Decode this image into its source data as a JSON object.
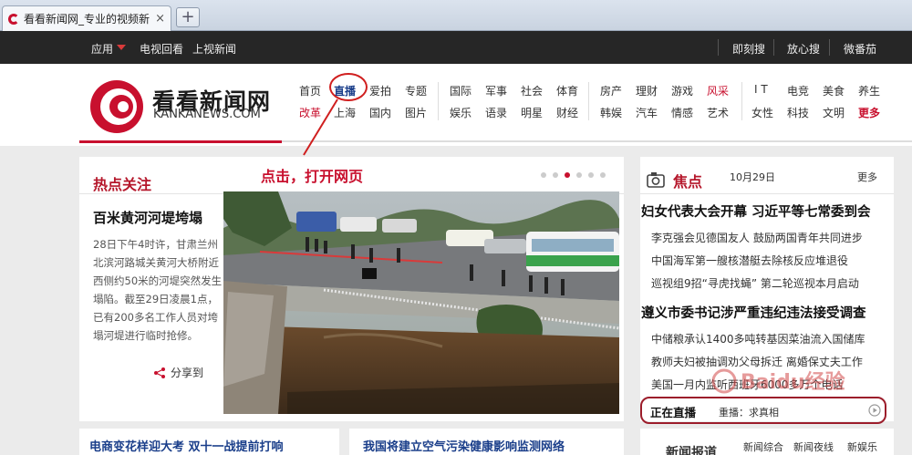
{
  "browser": {
    "tab_title": "看看新闻网_专业的视频新闻网",
    "close_glyph": "×",
    "newtab_glyph": "+"
  },
  "topnav": {
    "left": [
      "应用",
      "电视回看",
      "上视新闻"
    ],
    "right": [
      "即刻搜",
      "放心搜",
      "微番茄"
    ]
  },
  "brand": {
    "name": "看看新闻网",
    "domain": "KANKANEWS.COM",
    "color": "#c8102e"
  },
  "nav": {
    "rows": [
      [
        "首页",
        "直播",
        "爱拍",
        "专题",
        "国际",
        "军事",
        "社会",
        "体育",
        "房产",
        "理财",
        "游戏",
        "风采",
        "I T",
        "电竞",
        "美食",
        "养生"
      ],
      [
        "改革",
        "上海",
        "国内",
        "图片",
        "娱乐",
        "语录",
        "明星",
        "财经",
        "韩娱",
        "汽车",
        "情感",
        "艺术",
        "女性",
        "科技",
        "文明",
        "更多"
      ]
    ]
  },
  "annotation": {
    "text": "点击，打开网页"
  },
  "hot": {
    "title": "热点关注",
    "headline": "百米黄河河堤垮塌",
    "body": "28日下午4时许，甘肃兰州北滨河路城关黄河大桥附近西侧约50米的河堤突然发生塌陷。截至29日凌晨1点，已有200多名工作人员对垮塌河堤进行临时抢修。",
    "share": "分享到",
    "slide_count": 6,
    "active_slide": 3
  },
  "focus": {
    "title": "焦点",
    "date": "10月29日",
    "more": "更多",
    "headline1": "妇女代表大会开幕 习近平等七常委到会",
    "items1": [
      "李克强会见德国友人 鼓励两国青年共同进步",
      "中国海军第一艘核潜艇去除核反应堆退役",
      "巡视组9招“寻虎找蝇” 第二轮巡视本月启动"
    ],
    "headline2": "遵义市委书记涉严重违纪违法接受调查",
    "items2": [
      "中储粮承认1400多吨转基因菜油流入国储库",
      "教师夫妇被抽调劝父母拆迁 离婚保丈夫工作",
      "美国一月内监听西班牙6000多万个电话"
    ],
    "live_label": "正在直播",
    "live_text": "重播：求真相"
  },
  "bottom": {
    "link1": "电商变花样迎大考 双十一战提前打响",
    "link2": "我国将建立空气污染健康影响监测网络",
    "section": "新闻报道",
    "tabs": [
      "新闻综合",
      "新闻夜线",
      "新娱乐"
    ]
  },
  "watermark": {
    "text": "Baidu经验"
  }
}
